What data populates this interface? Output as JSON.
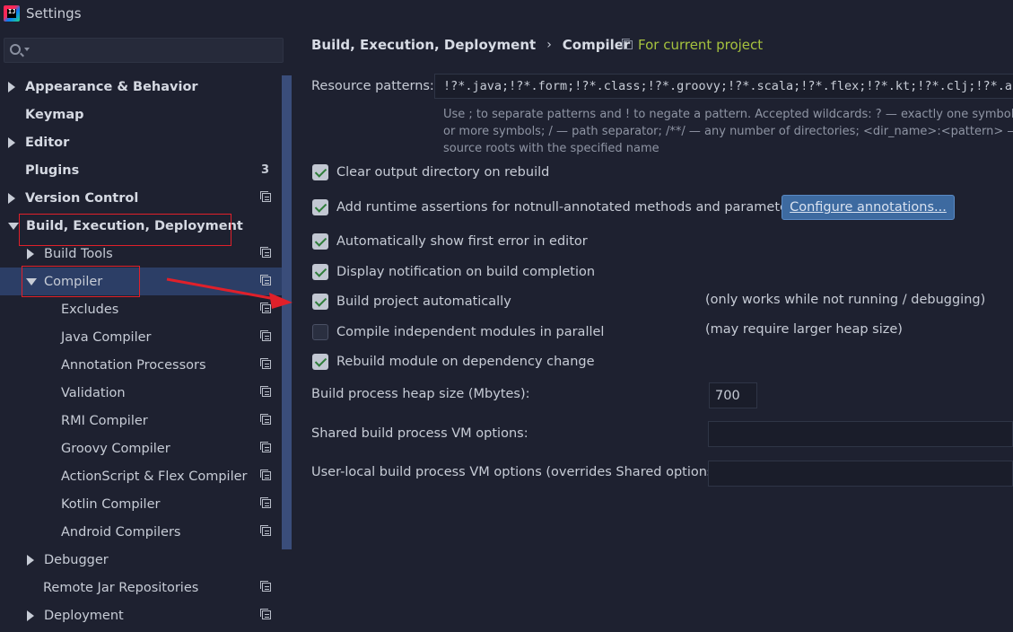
{
  "window": {
    "title": "Settings"
  },
  "search": {
    "value": "",
    "placeholder": ""
  },
  "sidebar": {
    "items": [
      {
        "label": "Appearance & Behavior"
      },
      {
        "label": "Keymap"
      },
      {
        "label": "Editor"
      },
      {
        "label": "Plugins",
        "count": "3"
      },
      {
        "label": "Version Control"
      },
      {
        "label": "Build, Execution, Deployment"
      },
      {
        "label": "Build Tools"
      },
      {
        "label": "Compiler"
      },
      {
        "label": "Excludes"
      },
      {
        "label": "Java Compiler"
      },
      {
        "label": "Annotation Processors"
      },
      {
        "label": "Validation"
      },
      {
        "label": "RMI Compiler"
      },
      {
        "label": "Groovy Compiler"
      },
      {
        "label": "ActionScript & Flex Compiler"
      },
      {
        "label": "Kotlin Compiler"
      },
      {
        "label": "Android Compilers"
      },
      {
        "label": "Debugger"
      },
      {
        "label": "Remote Jar Repositories"
      },
      {
        "label": "Deployment"
      }
    ]
  },
  "main": {
    "breadcrumb": [
      "Build, Execution, Deployment",
      "Compiler"
    ],
    "breadcrumb_separator": "›",
    "scope": "For current project",
    "resource_patterns": {
      "label": "Resource patterns:",
      "value": "!?*.java;!?*.form;!?*.class;!?*.groovy;!?*.scala;!?*.flex;!?*.kt;!?*.clj;!?*.aj"
    },
    "hint": {
      "line1": "Use ; to separate patterns and ! to negate a pattern. Accepted wildcards: ? — exactly one symbol; * — z",
      "line2": "or more symbols; / — path separator; /**/ — any number of directories; <dir_name>:<pattern> — rest",
      "line3": "source roots with the specified name"
    },
    "options": [
      {
        "label": "Clear output directory on rebuild",
        "checked": true
      },
      {
        "label": "Add runtime assertions for notnull-annotated methods and parameters",
        "checked": true
      },
      {
        "label": "Automatically show first error in editor",
        "checked": true
      },
      {
        "label": "Display notification on build completion",
        "checked": true
      },
      {
        "label": "Build project automatically",
        "checked": true
      },
      {
        "label": "Compile independent modules in parallel",
        "checked": false
      },
      {
        "label": "Rebuild module on dependency change",
        "checked": true
      }
    ],
    "configure_button": "Configure annotations...",
    "notes": {
      "build_auto": "(only works while not running / debugging)",
      "parallel": "(may require larger heap size)"
    },
    "heap": {
      "label": "Build process heap size (Mbytes):",
      "value": "700"
    },
    "shared_vm": {
      "label": "Shared build process VM options:",
      "value": ""
    },
    "user_vm": {
      "label": "User-local build process VM options (overrides Shared options):",
      "value": ""
    }
  },
  "colors": {
    "background": "#1e2130",
    "selection": "#2c3e66",
    "scope_text": "#a6c23e",
    "highlight_red": "#e0202a",
    "button": "#3d6aa0"
  }
}
